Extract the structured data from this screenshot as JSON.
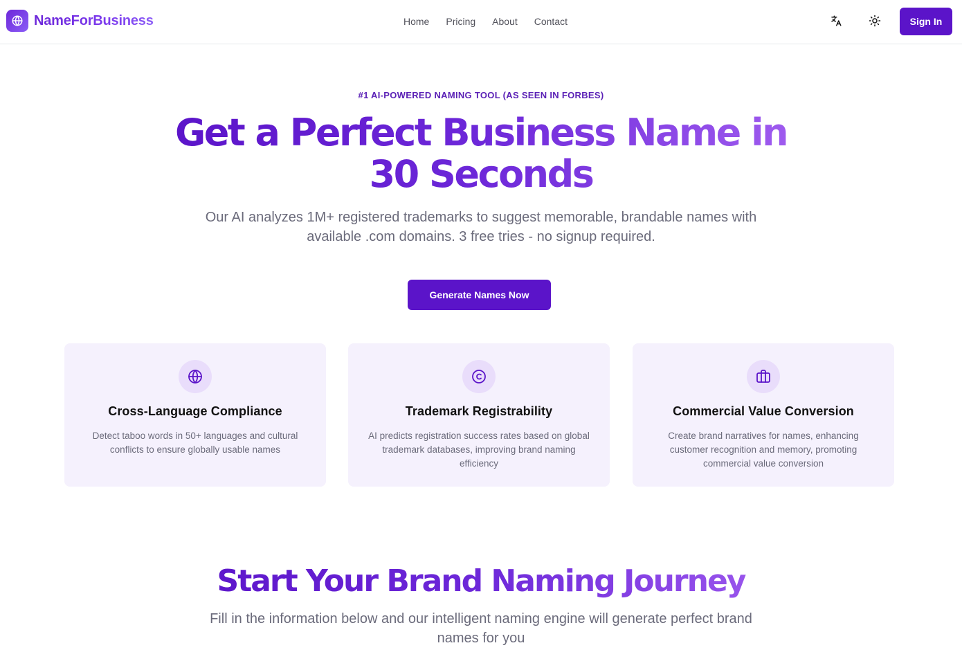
{
  "header": {
    "brand_name": "NameForBusiness",
    "brand_icon": "globe-icon",
    "nav": [
      {
        "label": "Home"
      },
      {
        "label": "Pricing"
      },
      {
        "label": "About"
      },
      {
        "label": "Contact"
      }
    ],
    "translate_icon": "translate-icon",
    "theme_icon": "sun-icon",
    "sign_in_label": "Sign In"
  },
  "hero": {
    "eyebrow": "#1 AI-POWERED NAMING TOOL (AS SEEN IN FORBES)",
    "title": "Get a Perfect Business Name in 30 Seconds",
    "subtitle": "Our AI analyzes 1M+ registered trademarks to suggest memorable, brandable names with available .com domains. 3 free tries - no signup required.",
    "cta_label": "Generate Names Now"
  },
  "features": [
    {
      "icon": "globe-icon",
      "title": "Cross-Language Compliance",
      "description": "Detect taboo words in 50+ languages and cultural conflicts to ensure globally usable names"
    },
    {
      "icon": "copyright-icon",
      "title": "Trademark Registrability",
      "description": "AI predicts registration success rates based on global trademark databases, improving brand naming efficiency"
    },
    {
      "icon": "briefcase-icon",
      "title": "Commercial Value Conversion",
      "description": "Create brand narratives for names, enhancing customer recognition and memory, promoting commercial value conversion"
    }
  ],
  "journey": {
    "title": "Start Your Brand Naming Journey",
    "subtitle": "Fill in the information below and our intelligent naming engine will generate perfect brand names for you"
  },
  "colors": {
    "primary": "#5b14c9",
    "gradient_end": "#9f5bef",
    "card_bg": "#f5f1fd",
    "icon_bg": "#e9ddfb",
    "muted_text": "#6b6b7b"
  }
}
